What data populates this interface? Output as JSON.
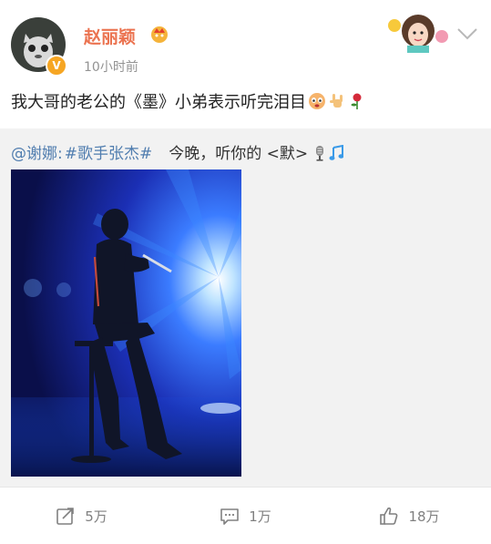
{
  "post": {
    "author": {
      "name": "赵丽颖",
      "verified_icon": "verified-v-badge-icon",
      "vip_icon": "vip-crown-badge-icon"
    },
    "timestamp": "10小时前",
    "text": "我大哥的老公的《墨》小弟表示听完泪目",
    "text_emoji_icons": [
      "crying-face-icon",
      "rock-hand-icon",
      "rose-icon"
    ],
    "repost": {
      "mention": "@谢娜",
      "separator": ":",
      "topic": "#歌手张杰#",
      "body": "今晚，听你的 <默>",
      "trailing_icons": [
        "microphone-icon",
        "music-note-icon"
      ]
    }
  },
  "actions": {
    "repost_count": "5万",
    "comment_count": "1万",
    "like_count": "18万"
  },
  "colors": {
    "username": "#eb7350",
    "link": "#507daf",
    "repost_bg": "#f2f2f2",
    "muted": "#939393"
  }
}
